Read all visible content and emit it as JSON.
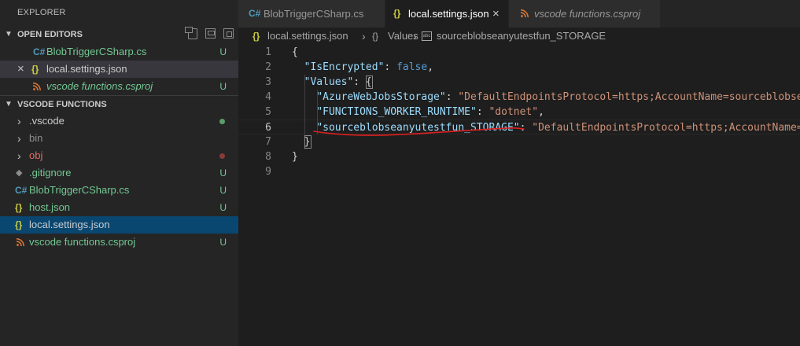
{
  "sidebar": {
    "title": "EXPLORER",
    "open_editors": {
      "label": "OPEN EDITORS",
      "items": [
        {
          "icon": "C#",
          "name": "BlobTriggerCSharp.cs",
          "status": "U"
        },
        {
          "icon": "{}",
          "name": "local.settings.json",
          "status": "",
          "close": "×"
        },
        {
          "icon": "rss",
          "name": "vscode functions.csproj",
          "status": "U"
        }
      ]
    },
    "folder": {
      "label": "VSCODE FUNCTIONS",
      "items": [
        {
          "name": ".vscode",
          "chevron": "›",
          "status_color": "#73c991"
        },
        {
          "name": "bin",
          "chevron": "›"
        },
        {
          "name": "obj",
          "chevron": "›",
          "status_color": "#c74e39"
        },
        {
          "icon": "◆",
          "name": ".gitignore",
          "status": "U"
        },
        {
          "icon": "C#",
          "name": "BlobTriggerCSharp.cs",
          "status": "U"
        },
        {
          "icon": "{}",
          "name": "host.json",
          "status": "U"
        },
        {
          "icon": "{}",
          "name": "local.settings.json",
          "status": ""
        },
        {
          "icon": "rss",
          "name": "vscode functions.csproj",
          "status": "U"
        }
      ]
    }
  },
  "tabs": [
    {
      "icon": "C#",
      "label": "BlobTriggerCSharp.cs"
    },
    {
      "icon": "{}",
      "label": "local.settings.json",
      "close": "×"
    },
    {
      "icon": "rss",
      "label": "vscode functions.csproj"
    }
  ],
  "breadcrumb": {
    "file_icon": "{}",
    "file": "local.settings.json",
    "sep1": "›",
    "obj_icon": "{}",
    "section": "Values",
    "sep2": "›",
    "str_icon": "abc",
    "key": "sourceblobseanyutestfun_STORAGE"
  },
  "editor": {
    "lines": [
      {
        "n": "1",
        "parts": [
          [
            "p",
            "{"
          ]
        ]
      },
      {
        "n": "2",
        "parts": [
          [
            "p",
            "  "
          ],
          [
            "k",
            "\"IsEncrypted\""
          ],
          [
            "p",
            ": "
          ],
          [
            "w",
            "false"
          ],
          [
            "p",
            ","
          ]
        ]
      },
      {
        "n": "3",
        "parts": [
          [
            "p",
            "  "
          ],
          [
            "k",
            "\"Values\""
          ],
          [
            "p",
            ": {"
          ]
        ]
      },
      {
        "n": "4",
        "parts": [
          [
            "p",
            "    "
          ],
          [
            "k",
            "\"AzureWebJobsStorage\""
          ],
          [
            "p",
            ": "
          ],
          [
            "s",
            "\"DefaultEndpointsProtocol=https;AccountName=sourceblobsea"
          ]
        ]
      },
      {
        "n": "5",
        "parts": [
          [
            "p",
            "    "
          ],
          [
            "k",
            "\"FUNCTIONS_WORKER_RUNTIME\""
          ],
          [
            "p",
            ": "
          ],
          [
            "s",
            "\"dotnet\""
          ],
          [
            "p",
            ","
          ]
        ]
      },
      {
        "n": "6",
        "parts": [
          [
            "p",
            "    "
          ],
          [
            "k",
            "\"sourceblobseanyutestfun_STORAGE\""
          ],
          [
            "p",
            ": "
          ],
          [
            "s",
            "\"DefaultEndpointsProtocol=https;AccountName=s"
          ]
        ]
      },
      {
        "n": "7",
        "parts": [
          [
            "p",
            "  }"
          ]
        ]
      },
      {
        "n": "8",
        "parts": [
          [
            "p",
            "}"
          ]
        ]
      },
      {
        "n": "9",
        "parts": []
      }
    ]
  }
}
